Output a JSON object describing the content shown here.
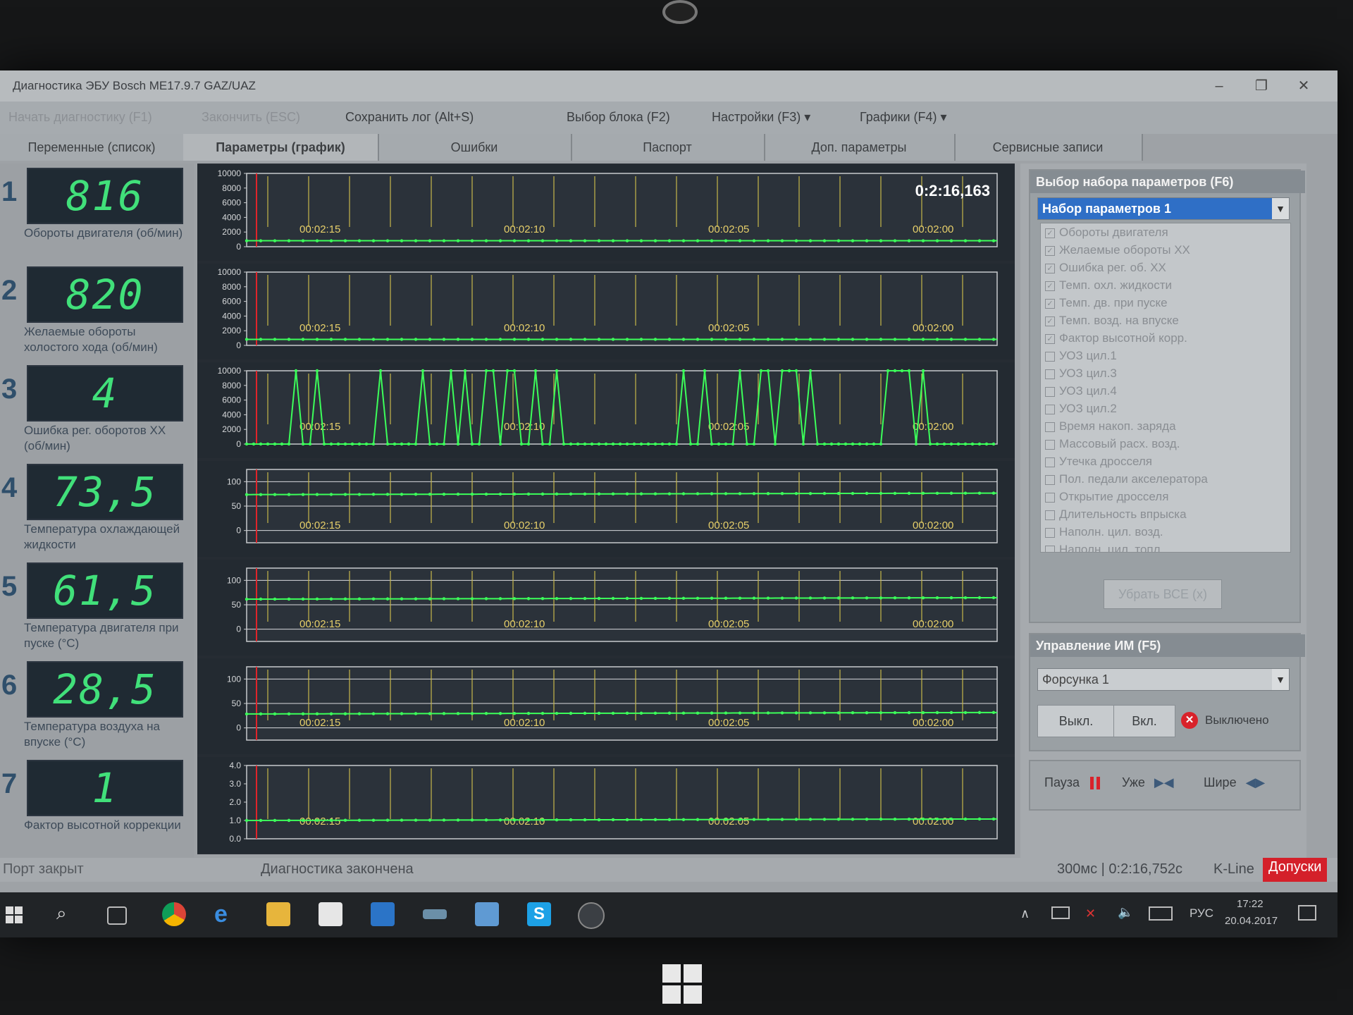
{
  "window": {
    "title": "Диагностика ЭБУ Bosch ME17.9.7 GAZ/UAZ",
    "minimize": "–",
    "maximize": "❐",
    "close": "✕"
  },
  "menu": {
    "start": "Начать диагностику (F1)",
    "stop": "Закончить (ESC)",
    "save_log": "Сохранить лог (Alt+S)",
    "select_block": "Выбор блока (F2)",
    "settings": "Настройки (F3) ▾",
    "graphs": "Графики (F4) ▾"
  },
  "tabs": [
    {
      "label": "Переменные (список)"
    },
    {
      "label": "Параметры (график)"
    },
    {
      "label": "Ошибки"
    },
    {
      "label": "Паспорт"
    },
    {
      "label": "Доп. параметры"
    },
    {
      "label": "Сервисные записи"
    }
  ],
  "params": [
    {
      "num": "1",
      "value": "816",
      "label": "Обороты двигателя (об/мин)"
    },
    {
      "num": "2",
      "value": "820",
      "label": "Желаемые обороты холостого хода (об/мин)"
    },
    {
      "num": "3",
      "value": "4",
      "label": "Ошибка рег. оборотов ХХ (об/мин)"
    },
    {
      "num": "4",
      "value": "73,5",
      "label": "Температура охлаждающей жидкости"
    },
    {
      "num": "5",
      "value": "61,5",
      "label": "Температура двигателя при пуске (°C)"
    },
    {
      "num": "6",
      "value": "28,5",
      "label": "Температура воздуха на впуске (°C)"
    },
    {
      "num": "7",
      "value": "1",
      "label": "Фактор высотной коррекции"
    }
  ],
  "chart_data": [
    {
      "type": "line",
      "title": "Обороты двигателя",
      "timer": "0:2:16,163",
      "x_ticks": [
        "00:02:15",
        "00:02:10",
        "00:02:05",
        "00:02:00"
      ],
      "y_ticks": [
        "10000",
        "8000",
        "6000",
        "4000",
        "2000",
        "0"
      ],
      "ylim": [
        0,
        10000
      ],
      "values": [
        816
      ]
    },
    {
      "type": "line",
      "title": "Желаемые обороты холостого хода",
      "x_ticks": [
        "00:02:15",
        "00:02:10",
        "00:02:05",
        "00:02:00"
      ],
      "y_ticks": [
        "10000",
        "8000",
        "6000",
        "4000",
        "2000",
        "0"
      ],
      "ylim": [
        0,
        10000
      ],
      "values": [
        820
      ]
    },
    {
      "type": "line",
      "title": "Ошибка рег. оборотов ХХ",
      "x_ticks": [
        "00:02:15",
        "00:02:10",
        "00:02:05",
        "00:02:00"
      ],
      "y_ticks": [
        "10000",
        "8000",
        "6000",
        "4000",
        "2000",
        "0"
      ],
      "ylim": [
        0,
        10000
      ],
      "values": [
        4
      ]
    },
    {
      "type": "line",
      "title": "Температура охлаждающей жидкости",
      "x_ticks": [
        "00:02:15",
        "00:02:10",
        "00:02:05",
        "00:02:00"
      ],
      "y_ticks": [
        "100",
        "50",
        "0"
      ],
      "ylim": [
        -25,
        125
      ],
      "values": [
        73.5
      ]
    },
    {
      "type": "line",
      "title": "Температура двигателя при пуске",
      "x_ticks": [
        "00:02:15",
        "00:02:10",
        "00:02:05",
        "00:02:00"
      ],
      "y_ticks": [
        "100",
        "50",
        "0"
      ],
      "ylim": [
        -25,
        125
      ],
      "values": [
        61.5
      ]
    },
    {
      "type": "line",
      "title": "Температура воздуха на впуске",
      "x_ticks": [
        "00:02:15",
        "00:02:10",
        "00:02:05",
        "00:02:00"
      ],
      "y_ticks": [
        "100",
        "50",
        "0"
      ],
      "ylim": [
        -25,
        125
      ],
      "values": [
        28.5
      ]
    },
    {
      "type": "line",
      "title": "Фактор высотной коррекции",
      "x_ticks": [
        "00:02:15",
        "00:02:10",
        "00:02:05",
        "00:02:00"
      ],
      "y_ticks": [
        "4.0",
        "3.0",
        "2.0",
        "1.0",
        "0.0"
      ],
      "ylim": [
        0,
        4
      ],
      "values": [
        1
      ]
    }
  ],
  "param_set": {
    "title": "Выбор набора параметров (F6)",
    "selected": "Набор параметров 1",
    "items": [
      {
        "label": "Обороты двигателя",
        "checked": true
      },
      {
        "label": "Желаемые обороты ХХ",
        "checked": true
      },
      {
        "label": "Ошибка рег. об. ХХ",
        "checked": true
      },
      {
        "label": "Темп. охл. жидкости",
        "checked": true
      },
      {
        "label": "Темп. дв. при пуске",
        "checked": true
      },
      {
        "label": "Темп. возд. на впуске",
        "checked": true
      },
      {
        "label": "Фактор высотной корр.",
        "checked": true
      },
      {
        "label": "УОЗ цил.1",
        "checked": false
      },
      {
        "label": "УОЗ цил.3",
        "checked": false
      },
      {
        "label": "УОЗ цил.4",
        "checked": false
      },
      {
        "label": "УОЗ цил.2",
        "checked": false
      },
      {
        "label": "Время накоп. заряда",
        "checked": false
      },
      {
        "label": "Массовый расх. возд.",
        "checked": false
      },
      {
        "label": "Утечка дросселя",
        "checked": false
      },
      {
        "label": "Пол. педали акселератора",
        "checked": false
      },
      {
        "label": "Открытие дросселя",
        "checked": false
      },
      {
        "label": "Длительность впрыска",
        "checked": false
      },
      {
        "label": "Наполн. цил. возд.",
        "checked": false
      },
      {
        "label": "Наполн. цил. топл.",
        "checked": false
      }
    ],
    "remove_all": "Убрать ВСЕ (x)"
  },
  "actuator": {
    "title": "Управление ИМ (F5)",
    "selected": "Форсунка 1",
    "off": "Выкл.",
    "on": "Вкл.",
    "state": "Выключено"
  },
  "controls": {
    "pause": "Пауза",
    "narrow": "Уже",
    "wide": "Шире"
  },
  "status": {
    "port": "Порт закрыт",
    "diag": "Диагностика закончена",
    "timing": "300мс | 0:2:16,752с",
    "interface": "K-Line",
    "tolerance": "Допуски"
  },
  "taskbar": {
    "lang": "РУС",
    "time": "17:22",
    "date": "20.04.2017"
  },
  "colors": {
    "lcd_text": "#41e07a",
    "plot_line": "#3cff5a",
    "grid_v": "#c8b84a",
    "cursor": "#e0242a",
    "tolerance_bg": "#d4202a"
  }
}
